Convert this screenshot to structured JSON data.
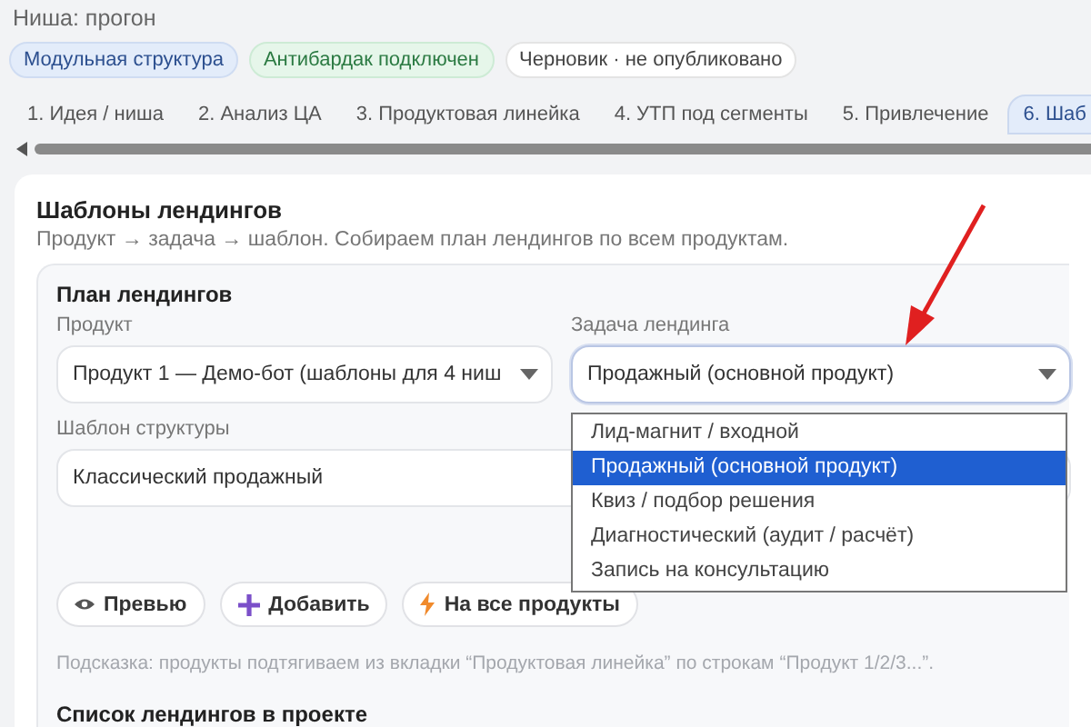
{
  "niche_label": "Ниша: прогон",
  "chips": [
    {
      "label": "Модульная структура",
      "kind": "info"
    },
    {
      "label": "Антибардак подключен",
      "kind": "success"
    },
    {
      "label": "Черновик · не опубликовано",
      "kind": "neutral"
    }
  ],
  "tabs": [
    {
      "label": "1. Идея / ниша",
      "selected": false
    },
    {
      "label": "2. Анализ ЦА",
      "selected": false
    },
    {
      "label": "3. Продуктовая линейка",
      "selected": false
    },
    {
      "label": "4. УТП под сегменты",
      "selected": false
    },
    {
      "label": "5. Привлечение",
      "selected": false
    },
    {
      "label": "6. Шаб",
      "selected": true
    }
  ],
  "card": {
    "title": "Шаблоны лендингов",
    "subtitle": "Продукт → задача → шаблон. Собираем план лендингов по всем продуктам.",
    "plan": {
      "title": "План лендингов",
      "fields": [
        {
          "label": "Продукт",
          "value": "Продукт 1 — Демо-бот (шаблоны для 4 ниш",
          "focused": false
        },
        {
          "label": "Задача лендинга",
          "value": "Продажный (основной продукт)",
          "focused": true
        },
        {
          "label": "Шаблон структуры",
          "value": "Классический продажный",
          "focused": false
        }
      ],
      "dropdown_options": [
        {
          "label": "Лид-магнит / входной",
          "selected": false
        },
        {
          "label": "Продажный (основной продукт)",
          "selected": true
        },
        {
          "label": "Квиз / подбор решения",
          "selected": false
        },
        {
          "label": "Диагностический (аудит / расчёт)",
          "selected": false
        },
        {
          "label": "Запись на консультацию",
          "selected": false
        }
      ],
      "buttons": [
        {
          "label": "Превью",
          "kind": "preview"
        },
        {
          "label": "Добавить",
          "kind": "add"
        },
        {
          "label": "На все продукты",
          "kind": "bulk"
        }
      ],
      "hint": "Подсказка: продукты подтягиваем из вкладки “Продуктовая линейка” по строкам “Продукт 1/2/3...”.",
      "list_title": "Список лендингов в проекте"
    }
  }
}
